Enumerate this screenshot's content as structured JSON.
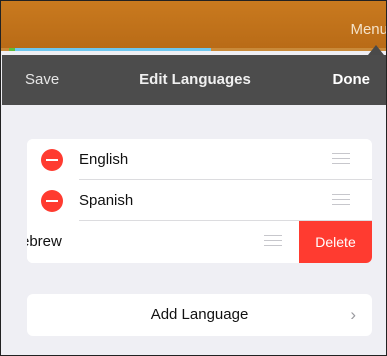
{
  "app_header": {
    "menu_label": "Menu"
  },
  "nav": {
    "save_label": "Save",
    "title": "Edit Languages",
    "done_label": "Done"
  },
  "languages": [
    {
      "label": "English"
    },
    {
      "label": "Spanish"
    },
    {
      "label": "ebrew"
    }
  ],
  "delete_label": "Delete",
  "add_language_label": "Add Language",
  "icons": {
    "remove": "minus-circle-icon",
    "reorder": "reorder-grip-icon",
    "chevron": "chevron-right-icon"
  },
  "colors": {
    "accent_red": "#ff3b30",
    "nav_bg": "#4c4c4c",
    "header_orange": "#c97a1f"
  }
}
